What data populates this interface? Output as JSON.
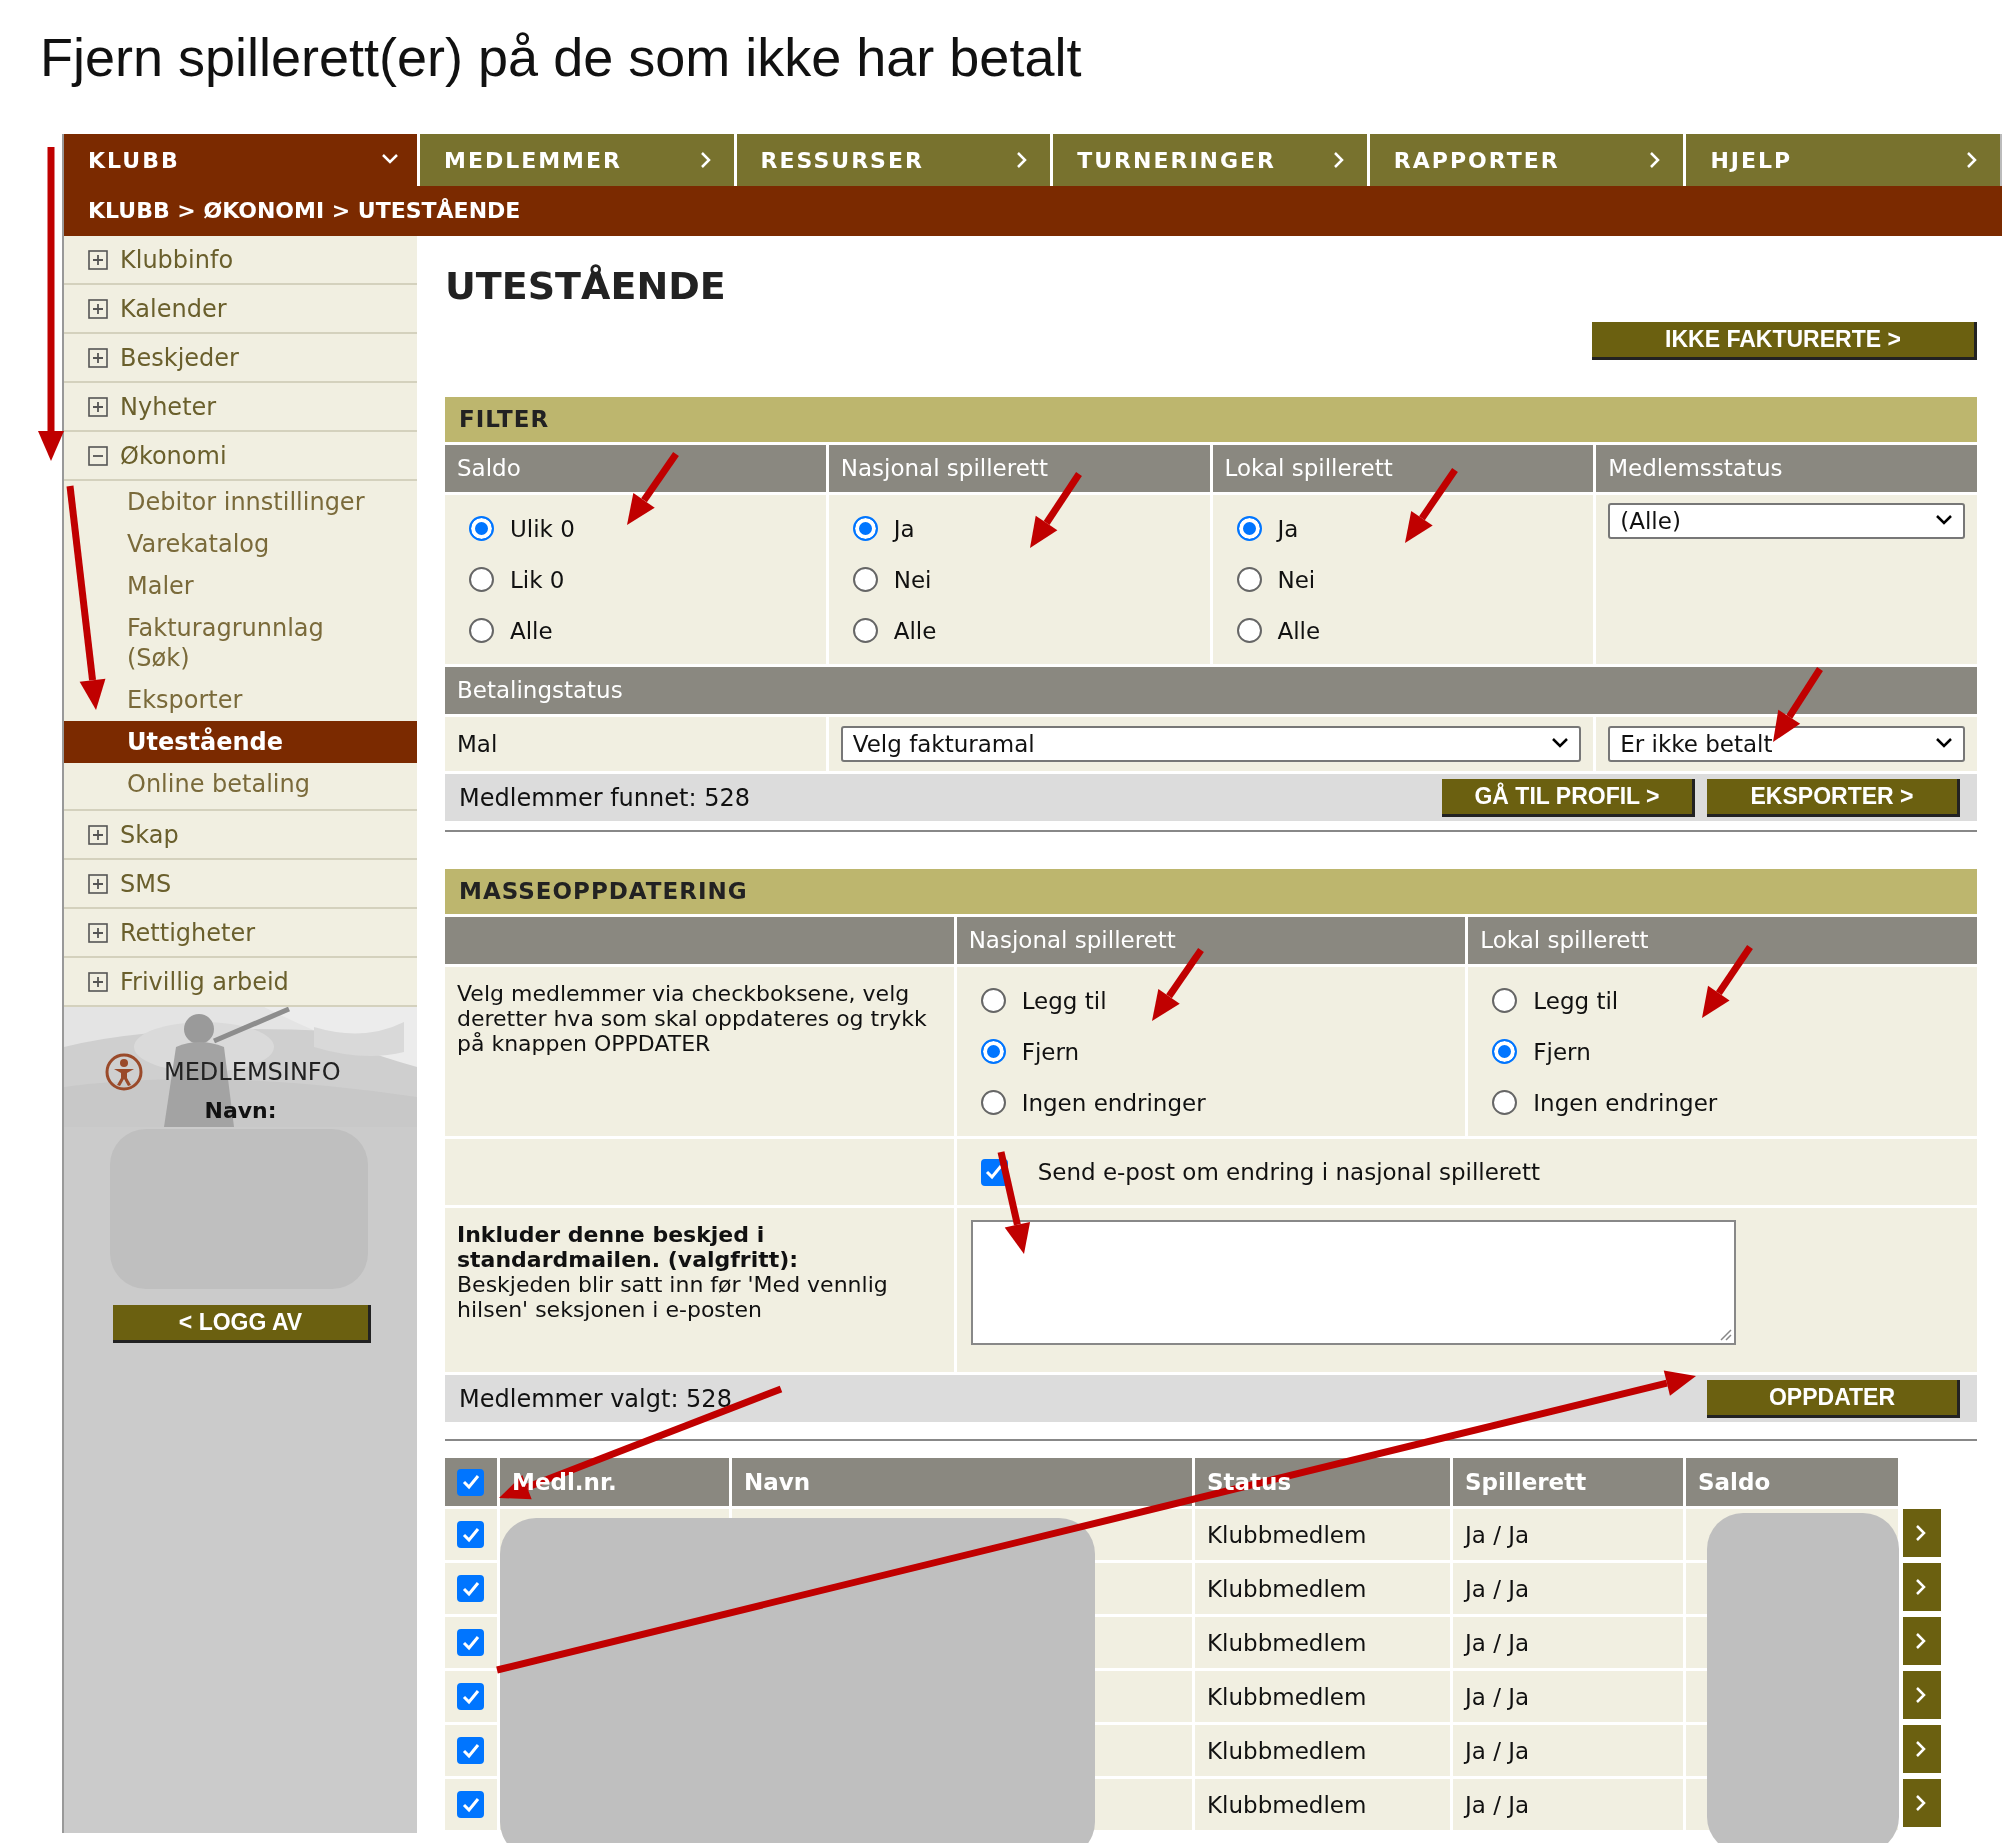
{
  "title": "Fjern spillerett(er) på de som ikke har betalt",
  "nav": [
    {
      "label": "KLUBB",
      "selected": true
    },
    {
      "label": "MEDLEMMER",
      "selected": false
    },
    {
      "label": "RESSURSER",
      "selected": false
    },
    {
      "label": "TURNERINGER",
      "selected": false
    },
    {
      "label": "RAPPORTER",
      "selected": false
    },
    {
      "label": "HJELP",
      "selected": false
    }
  ],
  "breadcrumb": "KLUBB > ØKONOMI > UTESTÅENDE",
  "sidebar": {
    "items": [
      {
        "label": "Klubbinfo",
        "expanded": false
      },
      {
        "label": "Kalender",
        "expanded": false
      },
      {
        "label": "Beskjeder",
        "expanded": false
      },
      {
        "label": "Nyheter",
        "expanded": false
      },
      {
        "label": "Økonomi",
        "expanded": true,
        "children": [
          {
            "label": "Debitor innstillinger",
            "selected": false
          },
          {
            "label": "Varekatalog",
            "selected": false
          },
          {
            "label": "Maler",
            "selected": false
          },
          {
            "label": "Fakturagrunnlag (Søk)",
            "selected": false
          },
          {
            "label": "Eksporter",
            "selected": false
          },
          {
            "label": "Utestående",
            "selected": true
          },
          {
            "label": "Online betaling",
            "selected": false
          }
        ]
      },
      {
        "label": "Skap",
        "expanded": false
      },
      {
        "label": "SMS",
        "expanded": false
      },
      {
        "label": "Rettigheter",
        "expanded": false
      },
      {
        "label": "Frivillig arbeid",
        "expanded": false
      }
    ]
  },
  "member_info": {
    "title": "MEDLEMSINFO",
    "name_label": "Navn:",
    "logout_button": "< LOGG AV"
  },
  "heading": "UTESTÅENDE",
  "top_button": "IKKE FAKTURERTE >",
  "filter": {
    "title": "FILTER",
    "groups": [
      {
        "header": "Saldo",
        "options": [
          {
            "label": "Ulik 0",
            "selected": true
          },
          {
            "label": "Lik 0",
            "selected": false
          },
          {
            "label": "Alle",
            "selected": false
          }
        ]
      },
      {
        "header": "Nasjonal spillerett",
        "options": [
          {
            "label": "Ja",
            "selected": true
          },
          {
            "label": "Nei",
            "selected": false
          },
          {
            "label": "Alle",
            "selected": false
          }
        ]
      },
      {
        "header": "Lokal spillerett",
        "options": [
          {
            "label": "Ja",
            "selected": true
          },
          {
            "label": "Nei",
            "selected": false
          },
          {
            "label": "Alle",
            "selected": false
          }
        ]
      }
    ],
    "member_status": {
      "header": "Medlemsstatus",
      "value": "(Alle)"
    },
    "payment_status": {
      "header": "Betalingstatus",
      "template_label": "Mal",
      "template_value": "Velg fakturamal",
      "status_value": "Er ikke betalt"
    },
    "found": "Medlemmer funnet: 528",
    "buttons": [
      "GÅ TIL PROFIL >",
      "EKSPORTER >"
    ]
  },
  "mass_update": {
    "title": "MASSEOPPDATERING",
    "instructions": "Velg medlemmer via checkboksene, velg deretter hva som skal oppdateres og trykk på knappen OPPDATER",
    "groups": [
      {
        "header": "Nasjonal spillerett",
        "options": [
          {
            "label": "Legg til",
            "selected": false
          },
          {
            "label": "Fjern",
            "selected": true
          },
          {
            "label": "Ingen endringer",
            "selected": false
          }
        ]
      },
      {
        "header": "Lokal spillerett",
        "options": [
          {
            "label": "Legg til",
            "selected": false
          },
          {
            "label": "Fjern",
            "selected": true
          },
          {
            "label": "Ingen endringer",
            "selected": false
          }
        ]
      }
    ],
    "send_email": {
      "label": "Send e-post om endring i nasjonal spillerett",
      "checked": true
    },
    "message_title": "Inkluder denne beskjed i standardmailen. (valgfritt):",
    "message_hint": "Beskjeden blir satt inn før 'Med vennlig hilsen' seksjonen i e-posten",
    "selected_count": "Medlemmer valgt: 528",
    "update_button": "OPPDATER"
  },
  "table": {
    "all_checked": true,
    "columns": [
      "Medl.nr.",
      "Navn",
      "Status",
      "Spillerett",
      "Saldo"
    ],
    "rows": [
      {
        "checked": true,
        "status": "Klubbmedlem",
        "spillerett": "Ja / Ja"
      },
      {
        "checked": true,
        "status": "Klubbmedlem",
        "spillerett": "Ja / Ja"
      },
      {
        "checked": true,
        "status": "Klubbmedlem",
        "spillerett": "Ja / Ja"
      },
      {
        "checked": true,
        "status": "Klubbmedlem",
        "spillerett": "Ja / Ja"
      },
      {
        "checked": true,
        "status": "Klubbmedlem",
        "spillerett": "Ja / Ja"
      },
      {
        "checked": true,
        "status": "Klubbmedlem",
        "spillerett": "Ja / Ja"
      }
    ]
  }
}
